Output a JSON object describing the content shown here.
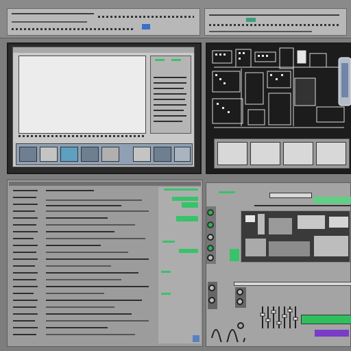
{
  "colors": {
    "accent_green": "#39c26a",
    "window_bg": "#c9c9c9",
    "panel_dark": "#2a2a2a",
    "page_bg": "#7d7d7d"
  },
  "icons": [
    "grid-icon",
    "folder-icon",
    "circuit-board-icon",
    "slider-icon",
    "waveform-icon",
    "toggle-icon"
  ]
}
